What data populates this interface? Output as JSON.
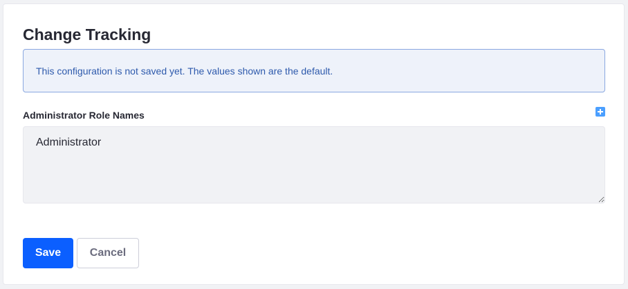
{
  "page": {
    "title": "Change Tracking"
  },
  "alert": {
    "message": "This configuration is not saved yet. The values shown are the default."
  },
  "field": {
    "label": "Administrator Role Names",
    "value": "Administrator",
    "add_icon": "plus-square-icon"
  },
  "actions": {
    "save_label": "Save",
    "cancel_label": "Cancel"
  },
  "colors": {
    "primary": "#0b5fff",
    "alert_background": "#eef2fa",
    "alert_border": "#89a7e0",
    "alert_text": "#2e5aac",
    "input_background": "#f1f2f5",
    "add_icon": "#4b9fff"
  }
}
